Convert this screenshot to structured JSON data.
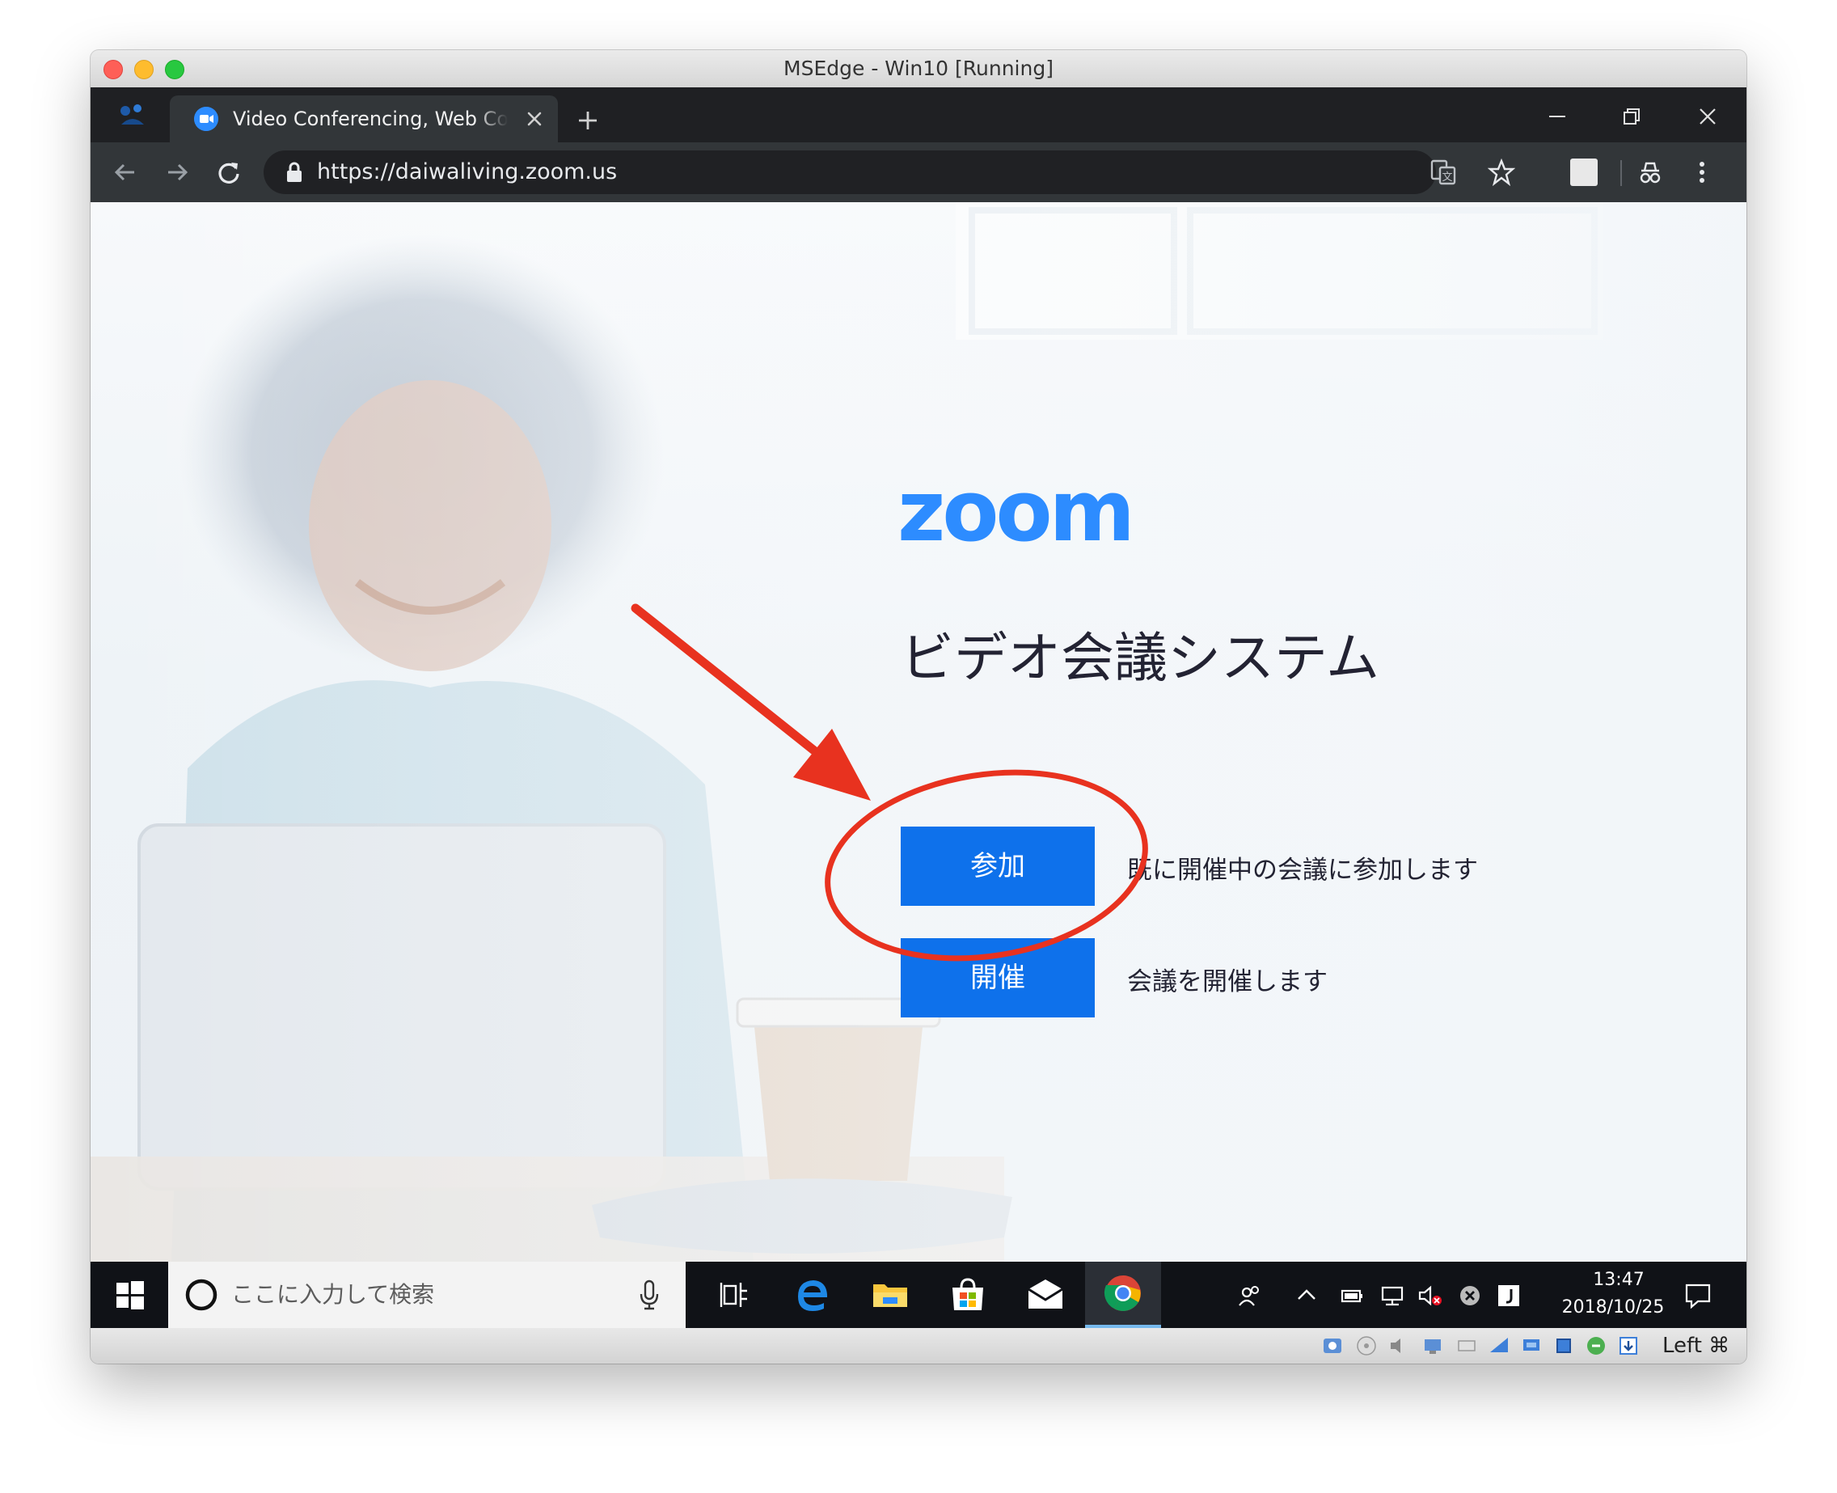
{
  "mac_window": {
    "title": "MSEdge - Win10 [Running]"
  },
  "browser": {
    "tab_title": "Video Conferencing, Web Conferencing",
    "url": "https://daiwaliving.zoom.us"
  },
  "page": {
    "logo_text": "zoom",
    "heading": "ビデオ会議システム",
    "join_button_label": "参加",
    "join_description": "既に開催中の会議に参加します",
    "host_button_label": "開催",
    "host_description": "会議を開催します"
  },
  "taskbar": {
    "search_placeholder": "ここに入力して検索",
    "time": "13:47",
    "date": "2018/10/25"
  },
  "vbox_status": {
    "host_key": "Left ⌘"
  },
  "colors": {
    "zoom_blue": "#2d8cff",
    "button_blue": "#0e71eb",
    "annotation_red": "#e8321f"
  },
  "icons": {
    "annotation": [
      "arrow-annotation",
      "circle-annotation"
    ],
    "taskbar_apps": [
      "task-view-icon",
      "edge-icon",
      "file-explorer-icon",
      "store-icon",
      "mail-icon",
      "chrome-icon"
    ]
  }
}
